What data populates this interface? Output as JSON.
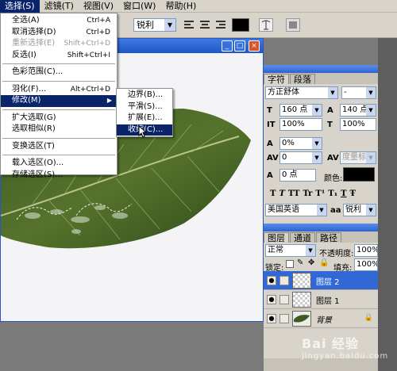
{
  "menubar": {
    "items": [
      {
        "label": "选择(S)",
        "active": true
      },
      {
        "label": "滤镜(T)"
      },
      {
        "label": "视图(V)"
      },
      {
        "label": "窗口(W)"
      },
      {
        "label": "帮助(H)"
      }
    ]
  },
  "options": {
    "antialias": "锐利",
    "text_color": "#000000"
  },
  "select_menu": {
    "items": [
      {
        "label": "全选(A)",
        "shortcut": "Ctrl+A"
      },
      {
        "label": "取消选择(D)",
        "shortcut": "Ctrl+D"
      },
      {
        "label": "重新选择(E)",
        "shortcut": "Shift+Ctrl+D",
        "disabled": true
      },
      {
        "label": "反选(I)",
        "shortcut": "Shift+Ctrl+I"
      },
      {
        "label": "色彩范围(C)..."
      },
      {
        "label": "羽化(F)...",
        "shortcut": "Alt+Ctrl+D"
      },
      {
        "label": "修改(M)",
        "highlighted": true,
        "submenu": true
      },
      {
        "label": "扩大选取(G)"
      },
      {
        "label": "选取相似(R)"
      },
      {
        "label": "变换选区(T)"
      },
      {
        "label": "载入选区(O)..."
      },
      {
        "label": "存储选区(S)..."
      }
    ]
  },
  "modify_submenu": {
    "items": [
      {
        "label": "边界(B)..."
      },
      {
        "label": "平滑(S)..."
      },
      {
        "label": "扩展(E)..."
      },
      {
        "label": "收缩(C)...",
        "highlighted": true
      }
    ]
  },
  "character_panel": {
    "tabs": [
      "字符",
      "段落"
    ],
    "font_family": "方正舒体",
    "font_style": "-",
    "font_size": "160 点",
    "leading": "140 点",
    "vertical_scale": "100%",
    "horizontal_scale": "100%",
    "tracking": "0%",
    "kerning": "0",
    "kerning_method": "度量标准",
    "baseline_shift": "0 点",
    "color_label": "颜色:",
    "color": "#000000",
    "format_buttons": [
      "T",
      "T",
      "TT",
      "Tr",
      "T¹",
      "T₁",
      "T",
      "Ŧ"
    ],
    "language": "美国英语",
    "antialias": "锐利"
  },
  "layers_panel": {
    "tabs": [
      "图层",
      "通道",
      "路径"
    ],
    "blend_mode": "正常",
    "opacity_label": "不透明度:",
    "opacity": "100%",
    "lock_label": "锁定:",
    "fill_label": "填充:",
    "fill": "100%",
    "layers": [
      {
        "name": "图层 2",
        "selected": true
      },
      {
        "name": "图层 1"
      },
      {
        "name": "背景",
        "locked": true
      }
    ]
  },
  "watermark": {
    "text": "Bai 经验",
    "sub": "jingyan.baidu.com"
  }
}
